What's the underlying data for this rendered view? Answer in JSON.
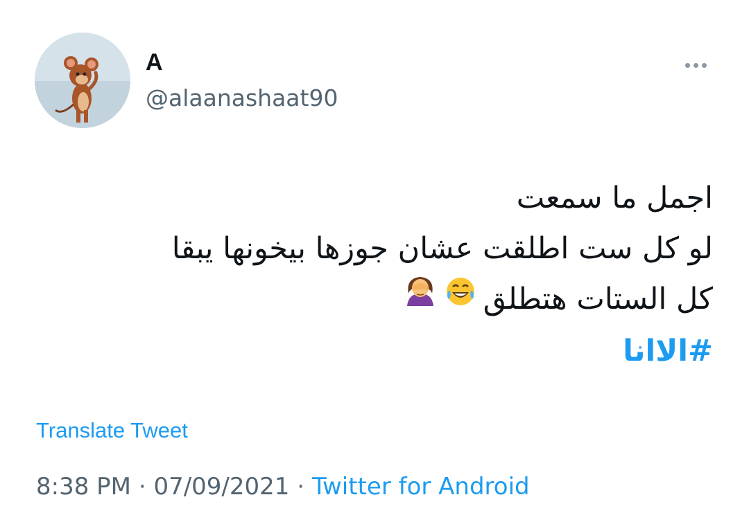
{
  "author": {
    "name": "A",
    "handle": "@alaanashaat90"
  },
  "tweet": {
    "lines": [
      "اجمل ما سمعت",
      "لو كل ست اطلقت عشان جوزها بيخونها يبقا",
      "كل الستات هتطلق"
    ],
    "emojis": [
      "tears-of-joy-icon",
      "facepalm-woman-icon"
    ],
    "hashtag": "#الاانا"
  },
  "translate_label": "Translate Tweet",
  "meta": {
    "time": "8:38 PM",
    "separator": "·",
    "date": "07/09/2021",
    "source": "Twitter for Android"
  },
  "colors": {
    "link": "#1d9bf0",
    "secondary": "#536471",
    "text": "#0f1419"
  }
}
